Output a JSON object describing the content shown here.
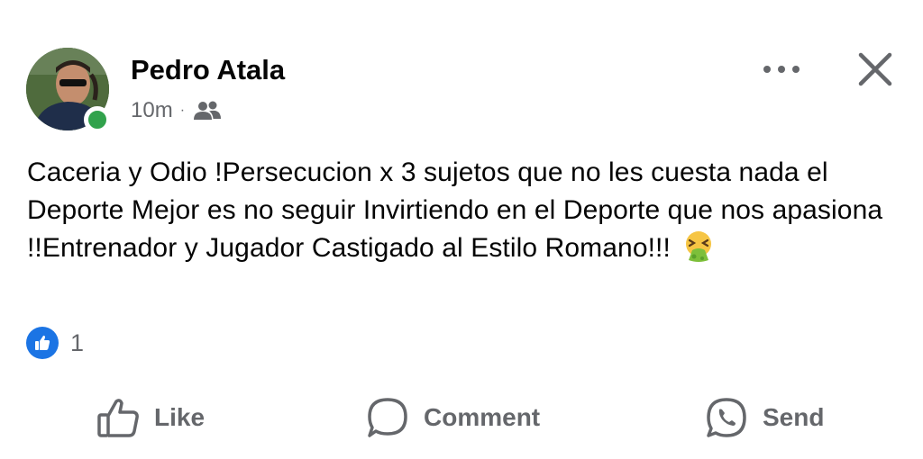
{
  "post": {
    "author": "Pedro Atala",
    "time": "10m",
    "separator": "·",
    "audience_icon": "friends-icon",
    "text": "Caceria y Odio !Persecucion x 3 sujetos que no les cuesta nada el Deporte Mejor es no seguir Invirtiendo en el Deporte que nos apasiona !!Entrenador y Jugador Castigado al Estilo Romano!!!",
    "emoji": "nauseated-vomiting-face"
  },
  "reactions": {
    "icon": "thumbs-up-icon",
    "count": "1"
  },
  "actions": {
    "like": "Like",
    "comment": "Comment",
    "send": "Send"
  },
  "colors": {
    "accent": "#1b74e4",
    "online": "#31a24c",
    "secondary_text": "#65676b",
    "primary_text": "#050505"
  }
}
